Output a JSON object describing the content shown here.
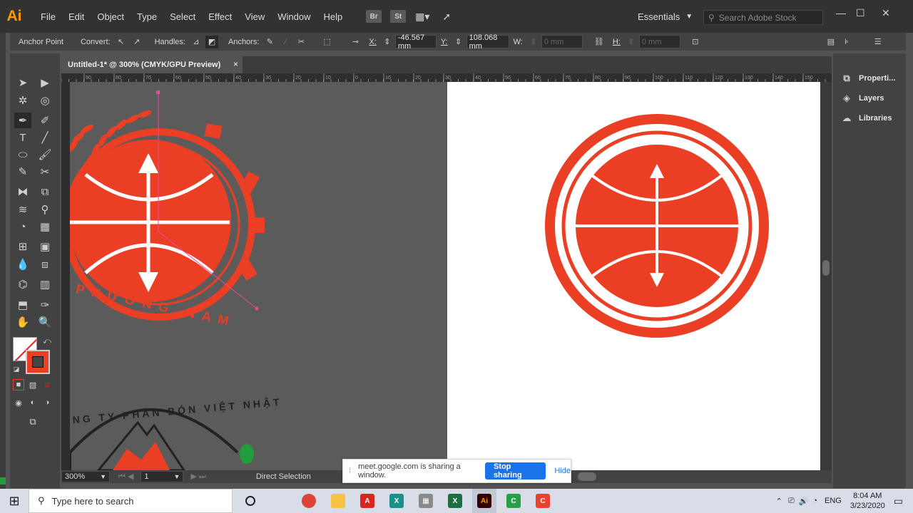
{
  "app": {
    "logo": "Ai",
    "menu": [
      "File",
      "Edit",
      "Object",
      "Type",
      "Select",
      "Effect",
      "View",
      "Window",
      "Help"
    ],
    "menu_icons": [
      "Br",
      "St"
    ],
    "workspace": "Essentials",
    "stock_search_placeholder": "Search Adobe Stock"
  },
  "controlbar": {
    "anchor_point": "Anchor Point",
    "convert": "Convert:",
    "handles": "Handles:",
    "anchors": "Anchors:",
    "x_label": "X:",
    "x_value": "-46.567 mm",
    "y_label": "Y:",
    "y_value": "108.068 mm",
    "w_label": "W:",
    "w_value": "0 mm",
    "h_label": "H:",
    "h_value": "0 mm"
  },
  "document": {
    "tab_title": "Untitled-1* @ 300% (CMYK/GPU Preview)",
    "close": "×",
    "ruler_marks": [
      "90",
      "80",
      "70",
      "60",
      "50",
      "40",
      "30",
      "20",
      "10",
      "0",
      "10",
      "20",
      "30",
      "40",
      "50",
      "60",
      "70",
      "80",
      "90",
      "100",
      "110",
      "120",
      "130",
      "140",
      "150"
    ],
    "logo_text_bottom": "PHƯƠNG NAM",
    "logo_text_arc": "NG TY PHÂN BÓN VIỆT NHẬT"
  },
  "statusbar": {
    "zoom": "300%",
    "page": "1",
    "tool": "Direct Selection"
  },
  "rightpanel": {
    "items": [
      "Properti...",
      "Layers",
      "Libraries"
    ]
  },
  "sharing": {
    "message": "meet.google.com is sharing a window.",
    "stop": "Stop sharing",
    "hide": "Hide"
  },
  "taskbar": {
    "search_placeholder": "Type here to search",
    "lang": "ENG",
    "time": "8:04 AM",
    "date": "3/23/2020"
  },
  "colors": {
    "accent_orange": "#ea3f24",
    "ui_dark": "#323232",
    "panel": "#424242",
    "meet_blue": "#1a73e8"
  }
}
